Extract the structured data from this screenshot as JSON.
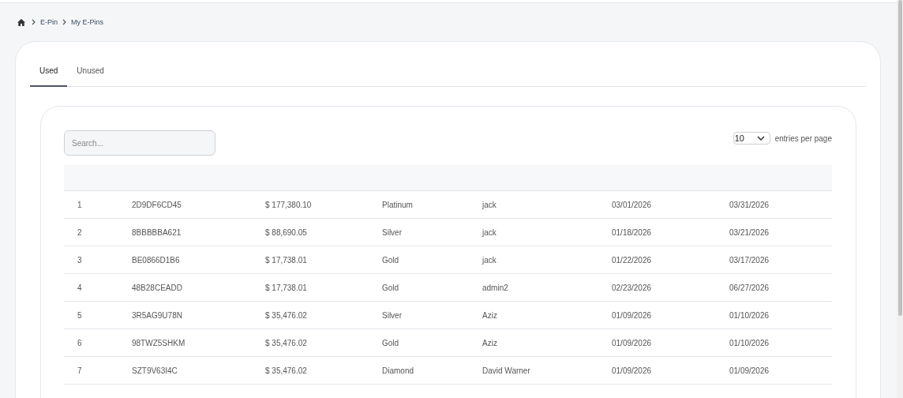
{
  "breadcrumb": {
    "items": [
      "E-Pin",
      "My E-Pins"
    ]
  },
  "tabs": [
    {
      "label": "Used",
      "selected": true
    },
    {
      "label": "Unused",
      "selected": false
    }
  ],
  "search": {
    "placeholder": "Search..."
  },
  "page_size": {
    "value": "10",
    "label": "entries per page"
  },
  "table": {
    "rows": [
      [
        "1",
        "2D9DF6CD45",
        "$ 177,380.10",
        "Platinum",
        "jack",
        "03/01/2026",
        "03/31/2026"
      ],
      [
        "2",
        "8BBBBBA621",
        "$ 88,690.05",
        "Silver",
        "jack",
        "01/18/2026",
        "03/21/2026"
      ],
      [
        "3",
        "BE0866D1B6",
        "$ 17,738.01",
        "Gold",
        "jack",
        "01/22/2026",
        "03/17/2026"
      ],
      [
        "4",
        "48B28CEADD",
        "$ 17,738.01",
        "Gold",
        "admin2",
        "02/23/2026",
        "06/27/2026"
      ],
      [
        "5",
        "3R5AG9U78N",
        "$ 35,476.02",
        "Silver",
        "Aziz",
        "01/09/2026",
        "01/10/2026"
      ],
      [
        "6",
        "98TWZ5SHKM",
        "$ 35,476.02",
        "Gold",
        "Aziz",
        "01/09/2026",
        "01/10/2026"
      ],
      [
        "7",
        "SZT9V63I4C",
        "$ 35,476.02",
        "Diamond",
        "David Warner",
        "01/09/2026",
        "01/09/2026"
      ]
    ]
  }
}
